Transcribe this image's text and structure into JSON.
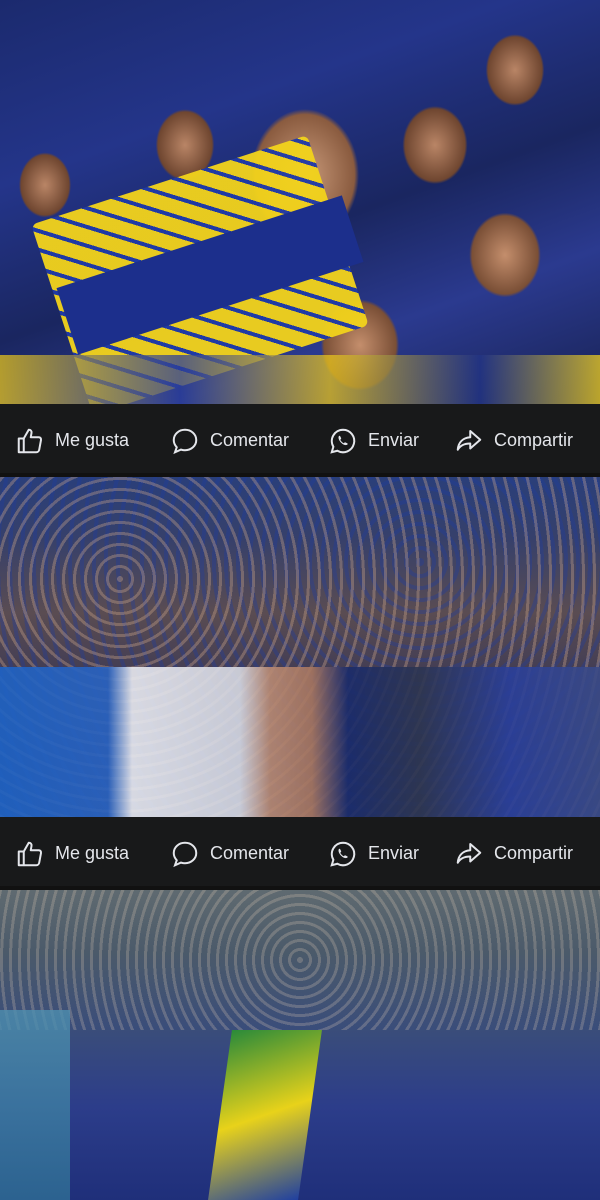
{
  "feed": {
    "posts": [
      {
        "image_description": "",
        "actions": {
          "like_label": "Me gusta",
          "comment_label": "Comentar",
          "send_label": "Enviar",
          "share_label": "Compartir"
        }
      },
      {
        "actions": {
          "like_label": "Me gusta",
          "comment_label": "Comentar",
          "send_label": "Enviar",
          "share_label": "Compartir"
        }
      },
      {}
    ]
  },
  "icons": {
    "like": "thumbs-up-icon",
    "comment": "speech-bubble-icon",
    "send": "whatsapp-icon",
    "share": "share-arrow-icon"
  },
  "colors": {
    "background": "#18191a",
    "text": "#e4e6eb"
  }
}
